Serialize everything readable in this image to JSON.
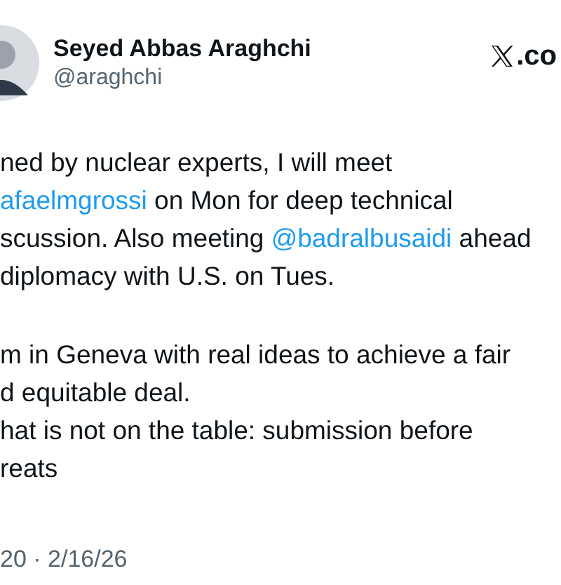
{
  "author": {
    "name": "Seyed Abbas Araghchi",
    "handle": "@araghchi"
  },
  "source": {
    "label": ".co"
  },
  "paragraphs": [
    [
      [
        {
          "kind": "text",
          "text": "ned by nuclear experts, I will meet"
        }
      ],
      [
        {
          "kind": "mention",
          "text": "afaelmgrossi"
        },
        {
          "kind": "text",
          "text": " on Mon for deep technical"
        }
      ],
      [
        {
          "kind": "text",
          "text": "scussion. Also meeting "
        },
        {
          "kind": "mention",
          "text": "@badralbusaidi"
        },
        {
          "kind": "text",
          "text": " ahead"
        }
      ],
      [
        {
          "kind": "text",
          "text": "diplomacy with U.S. on Tues."
        }
      ]
    ],
    [
      [
        {
          "kind": "text",
          "text": "m in Geneva with real ideas to achieve a fair"
        }
      ],
      [
        {
          "kind": "text",
          "text": "d equitable deal."
        }
      ],
      [
        {
          "kind": "text",
          "text": "hat is not on the table: submission before"
        }
      ],
      [
        {
          "kind": "text",
          "text": "reats"
        }
      ]
    ]
  ],
  "timestamp": "20 · 2/16/26"
}
